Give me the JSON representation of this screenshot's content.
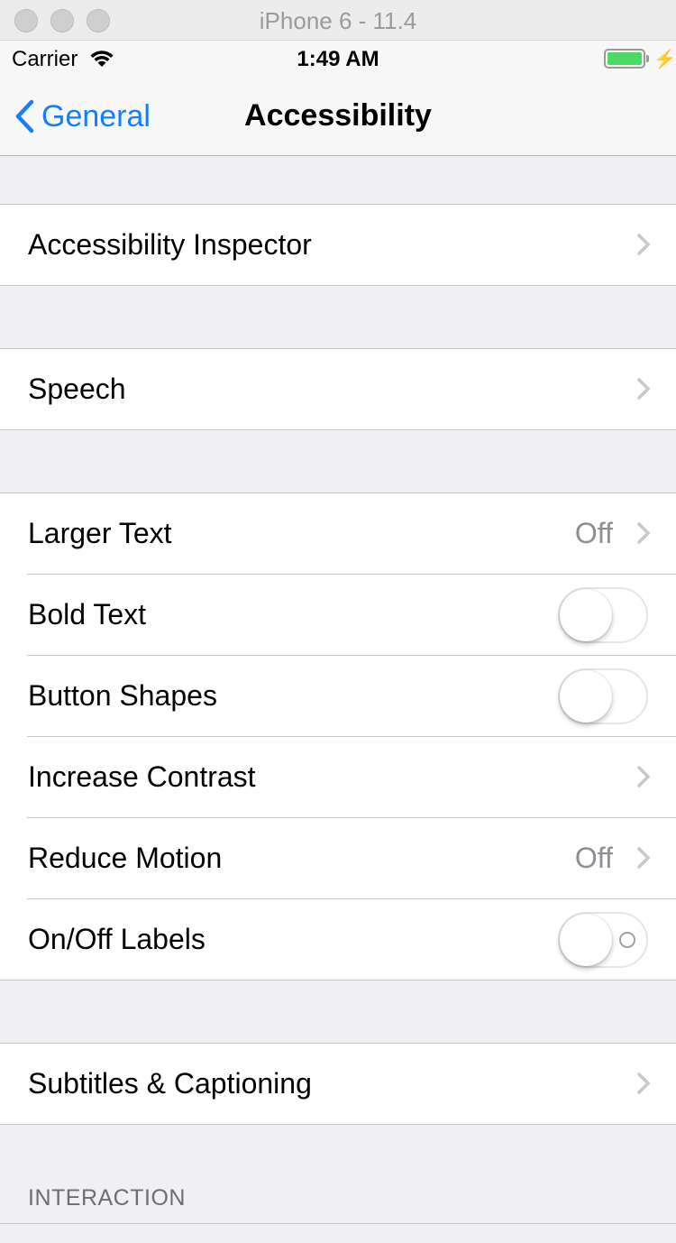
{
  "window": {
    "title": "iPhone 6 - 11.4"
  },
  "status_bar": {
    "carrier": "Carrier",
    "time": "1:49 AM",
    "battery_color": "#4cd964"
  },
  "nav": {
    "back_label": "General",
    "title": "Accessibility"
  },
  "groups": {
    "inspector": {
      "label": "Accessibility Inspector"
    },
    "speech": {
      "label": "Speech"
    },
    "vision": [
      {
        "label": "Larger Text",
        "value": "Off"
      },
      {
        "label": "Bold Text",
        "toggle": false
      },
      {
        "label": "Button Shapes",
        "toggle": false
      },
      {
        "label": "Increase Contrast"
      },
      {
        "label": "Reduce Motion",
        "value": "Off"
      },
      {
        "label": "On/Off Labels",
        "toggle": false
      }
    ],
    "subtitles": {
      "label": "Subtitles & Captioning"
    }
  },
  "section_header": "INTERACTION",
  "colors": {
    "accent": "#147efb",
    "background": "#efeff4",
    "separator": "#c8c7cc"
  }
}
